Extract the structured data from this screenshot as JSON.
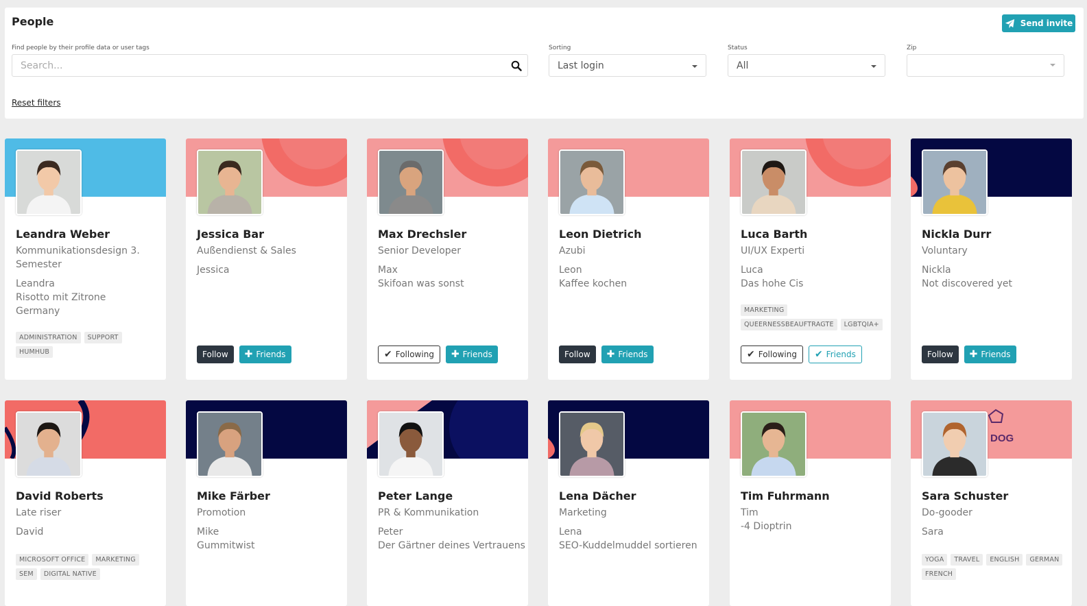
{
  "header": {
    "title": "People",
    "invite_label": "Send invite"
  },
  "filters": {
    "search_label": "Find people by their profile data or user tags",
    "search_placeholder": "Search...",
    "sorting_label": "Sorting",
    "sorting_value": "Last login",
    "status_label": "Status",
    "status_value": "All",
    "zip_label": "Zip",
    "zip_value": "",
    "reset_label": "Reset filters"
  },
  "colors": {
    "accent": "#21a1b3",
    "dark_button": "#2d3640",
    "banner_blue": "#4fbbe6",
    "banner_coral": "#f49a9a",
    "banner_red": "#f26b66",
    "banner_navy": "#040842"
  },
  "cards": [
    {
      "name": "Leandra Weber",
      "title": "Kommunikationsdesign 3. Semester",
      "info": [
        "Leandra",
        "Risotto mit Zitrone",
        "Germany"
      ],
      "tags": [
        "ADMINISTRATION",
        "SUPPORT",
        "HUMHUB"
      ],
      "buttons": [],
      "banner": "blue"
    },
    {
      "name": "Jessica Bar",
      "title": "Außendienst & Sales",
      "info": [
        "Jessica"
      ],
      "tags": [],
      "follow": "Follow",
      "friends": "Friends",
      "banner": "coral"
    },
    {
      "name": "Max Drechsler",
      "title": "Senior Developer",
      "info": [
        "Max",
        "Skifoan was sonst"
      ],
      "tags": [],
      "follow": "Following",
      "friends": "Friends",
      "banner": "coral"
    },
    {
      "name": "Leon Dietrich",
      "title": "Azubi",
      "info": [
        "Leon",
        "Kaffee kochen"
      ],
      "tags": [],
      "follow": "Follow",
      "friends": "Friends",
      "banner": "coral-plain"
    },
    {
      "name": "Luca Barth",
      "title": "UI/UX Experti",
      "info": [
        "Luca",
        "Das hohe Cis"
      ],
      "tags": [
        "MARKETING",
        "QUEERNESSBEAUFTRAGTE",
        "LGBTQIA+"
      ],
      "follow": "Following",
      "friends": "Friends",
      "banner": "coral"
    },
    {
      "name": "Nickla Durr",
      "title": "Voluntary",
      "info": [
        "Nickla",
        "Not discovered yet"
      ],
      "tags": [],
      "follow": "Follow",
      "friends": "Friends",
      "banner": "navy"
    },
    {
      "name": "David Roberts",
      "title": "Late riser",
      "info": [
        "David"
      ],
      "tags": [
        "MICROSOFT OFFICE",
        "MARKETING",
        "SEM",
        "DIGITAL NATIVE"
      ],
      "banner": "red"
    },
    {
      "name": "Mike Färber",
      "title": "Promotion",
      "info": [
        "Mike",
        "Gummitwist"
      ],
      "tags": [],
      "banner": "navy-plain"
    },
    {
      "name": "Peter Lange",
      "title": "PR & Kommunikation",
      "info": [
        "Peter",
        "Der Gärtner deines Vertrauens"
      ],
      "tags": [],
      "banner": "navy-coral"
    },
    {
      "name": "Lena Dächer",
      "title": "Marketing",
      "info": [
        "Lena",
        "SEO-Kuddelmuddel sortieren"
      ],
      "tags": [],
      "banner": "navy"
    },
    {
      "name": "Tim Fuhrmann",
      "title": "",
      "info": [
        "Tim",
        "-4 Dioptrin"
      ],
      "tags": [],
      "banner": "coral-plain"
    },
    {
      "name": "Sara Schuster",
      "title": "Do-gooder",
      "info": [
        "Sara"
      ],
      "tags": [
        "YOGA",
        "TRAVEL",
        "ENGLISH",
        "GERMAN",
        "FRENCH"
      ],
      "banner": "coral-logo",
      "banner_logo_text": "DOG"
    }
  ]
}
